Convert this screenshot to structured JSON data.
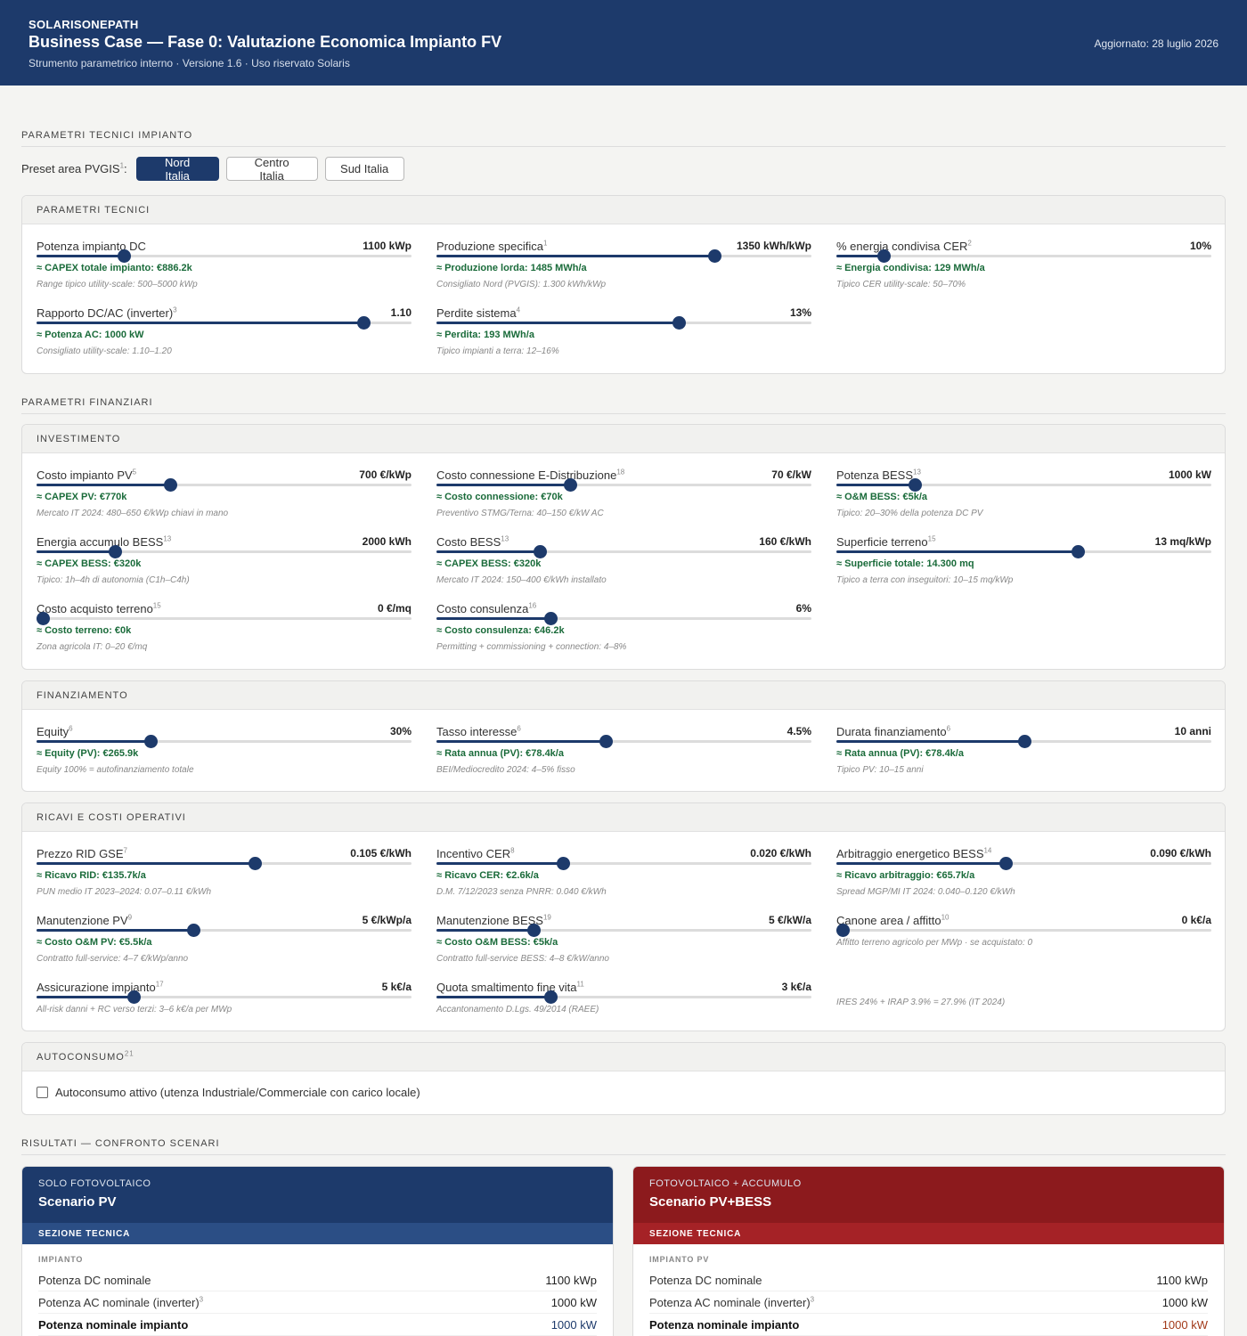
{
  "header": {
    "brand": "SOLARISONEPATH",
    "title": "Business Case — Fase 0: Valutazione Economica Impianto FV",
    "subtitle": "Strumento parametrico interno · Versione 1.6 · Uso riservato Solaris",
    "updated": "Aggiornato: 28 luglio 2026"
  },
  "sections": {
    "tech": "PARAMETRI TECNICI IMPIANTO",
    "fin": "PARAMETRI FINANZIARI",
    "results": "RISULTATI — CONFRONTO SCENARI"
  },
  "preset": {
    "label": "Preset area PVGIS",
    "sup": "1",
    "suffix": ":",
    "options": [
      "Nord Italia",
      "Centro Italia",
      "Sud Italia"
    ],
    "selected": "Nord Italia"
  },
  "cards": {
    "tecnici": {
      "title": "PARAMETRI TECNICI",
      "params": [
        {
          "label": "Potenza impianto DC",
          "sup": "",
          "value": "1100 kWp",
          "level": 0.233,
          "est": "≈ CAPEX totale impianto: €886.2k",
          "hint": "Range tipico utility-scale: 500–5000 kWp"
        },
        {
          "label": "Produzione specifica",
          "sup": "1",
          "value": "1350 kWh/kWp",
          "level": 0.74,
          "est": "≈ Produzione lorda: 1485 MWh/a",
          "hint": "Consigliato Nord (PVGIS): 1.300 kWh/kWp"
        },
        {
          "label": "% energia condivisa CER",
          "sup": "2",
          "value": "10%",
          "level": 0.125,
          "est": "≈ Energia condivisa: 129 MWh/a",
          "hint": "Tipico CER utility-scale: 50–70%"
        },
        {
          "label": "Rapporto DC/AC (inverter)",
          "sup": "3",
          "value": "1.10",
          "level": 0.872,
          "est": "≈ Potenza AC: 1000 kW",
          "hint": "Consigliato utility-scale: 1.10–1.20"
        },
        {
          "label": "Perdite sistema",
          "sup": "4",
          "value": "13%",
          "level": 0.645,
          "est": "≈ Perdita: 193 MWh/a",
          "hint": "Tipico impianti a terra: 12–16%"
        }
      ]
    },
    "investimento": {
      "title": "INVESTIMENTO",
      "params": [
        {
          "label": "Costo impianto PV",
          "sup": "5",
          "value": "700 €/kWp",
          "level": 0.357,
          "est": "≈ CAPEX PV: €770k",
          "hint": "Mercato IT 2024: 480–650 €/kWp chiavi in mano"
        },
        {
          "label": "Costo connessione E-Distribuzione",
          "sup": "18",
          "value": "70 €/kW",
          "level": 0.357,
          "est": "≈ Costo connessione: €70k",
          "hint": "Preventivo STMG/Terna: 40–150 €/kW AC"
        },
        {
          "label": "Potenza BESS",
          "sup": "13",
          "value": "1000 kW",
          "level": 0.21,
          "est": "≈ O&M BESS: €5k/a",
          "hint": "Tipico: 20–30% della potenza DC PV"
        },
        {
          "label": "Energia accumulo BESS",
          "sup": "13",
          "value": "2000 kWh",
          "level": 0.21,
          "est": "≈ CAPEX BESS: €320k",
          "hint": "Tipico: 1h–4h di autonomia (C1h–C4h)"
        },
        {
          "label": "Costo BESS",
          "sup": "13",
          "value": "160 €/kWh",
          "level": 0.276,
          "est": "≈ CAPEX BESS: €320k",
          "hint": "Mercato IT 2024: 150–400 €/kWh installato"
        },
        {
          "label": "Superficie terreno",
          "sup": "15",
          "value": "13 mq/kWp",
          "level": 0.643,
          "est": "≈ Superficie totale: 14.300 mq",
          "hint": "Tipico a terra con inseguitori: 10–15 mq/kWp"
        },
        {
          "label": "Costo acquisto terreno",
          "sup": "15",
          "value": "0 €/mq",
          "level": 0.017,
          "est": "≈ Costo terreno: €0k",
          "hint": "Zona agricola IT: 0–20 €/mq"
        },
        {
          "label": "Costo consulenza",
          "sup": "16",
          "value": "6%",
          "level": 0.305,
          "est": "≈ Costo consulenza: €46.2k",
          "hint": "Permitting + commissioning + connection: 4–8%"
        }
      ]
    },
    "finanziamento": {
      "title": "FINANZIAMENTO",
      "params": [
        {
          "label": "Equity",
          "sup": "6",
          "value": "30%",
          "level": 0.305,
          "est": "≈ Equity (PV): €265.9k",
          "hint": "Equity 100% = autofinanziamento totale"
        },
        {
          "label": "Tasso interesse",
          "sup": "6",
          "value": "4.5%",
          "level": 0.452,
          "est": "≈ Rata annua (PV): €78.4k/a",
          "hint": "BEI/Mediocredito 2024: 4–5% fisso"
        },
        {
          "label": "Durata finanziamento",
          "sup": "6",
          "value": "10 anni",
          "level": 0.5,
          "est": "≈ Rata annua (PV): €78.4k/a",
          "hint": "Tipico PV: 10–15 anni"
        }
      ]
    },
    "ricavi": {
      "title": "RICAVI E COSTI OPERATIVI",
      "params": [
        {
          "label": "Prezzo RID GSE",
          "sup": "7",
          "value": "0.105 €/kWh",
          "level": 0.581,
          "est": "≈ Ricavo RID: €135.7k/a",
          "hint": "PUN medio IT 2023–2024: 0.07–0.11 €/kWh"
        },
        {
          "label": "Incentivo CER",
          "sup": "8",
          "value": "0.020 €/kWh",
          "level": 0.338,
          "est": "≈ Ricavo CER: €2.6k/a",
          "hint": "D.M. 7/12/2023 senza PNRR: 0.040 €/kWh"
        },
        {
          "label": "Arbitraggio energetico BESS",
          "sup": "14",
          "value": "0.090 €/kWh",
          "level": 0.452,
          "est": "≈ Ricavo arbitraggio: €65.7k/a",
          "hint": "Spread MGP/MI IT 2024: 0.040–0.120 €/kWh"
        },
        {
          "label": "Manutenzione PV",
          "sup": "9",
          "value": "5 €/kWp/a",
          "level": 0.419,
          "est": "≈ Costo O&M PV: €5.5k/a",
          "hint": "Contratto full-service: 4–7 €/kWp/anno"
        },
        {
          "label": "Manutenzione BESS",
          "sup": "19",
          "value": "5 €/kW/a",
          "level": 0.26,
          "est": "≈ Costo O&M BESS: €5k/a",
          "hint": "Contratto full-service BESS: 4–8 €/kW/anno"
        },
        {
          "label": "Canone area / affitto",
          "sup": "10",
          "value": "0 k€/a",
          "level": 0.017,
          "est": "",
          "hint": "Affitto terreno agricolo per MWp · se acquistato: 0"
        },
        {
          "label": "Assicurazione impianto",
          "sup": "17",
          "value": "5 k€/a",
          "level": 0.26,
          "est": "",
          "hint": "All-risk danni + RC verso terzi: 3–6 k€/a per MWp"
        },
        {
          "label": "Quota smaltimento fine vita",
          "sup": "11",
          "value": "3 k€/a",
          "level": 0.305,
          "est": "",
          "hint": "Accantonamento D.Lgs. 49/2014 (RAEE)"
        }
      ],
      "tax_note": "IRES 24% + IRAP 3.9% = 27.9% (IT 2024)"
    },
    "autoconsumo": {
      "title": "AUTOCONSUMO",
      "sup": "21",
      "checkbox_label": "Autoconsumo attivo (utenza Industriale/Commerciale con carico locale)",
      "checked": false
    }
  },
  "scenarios": {
    "pv": {
      "kicker": "SOLO FOTOVOLTAICO",
      "name": "Scenario PV",
      "section": "SEZIONE TECNICA",
      "group": "IMPIANTO",
      "rows": [
        {
          "label": "Potenza DC nominale",
          "sup": "",
          "value": "1100 kWp"
        },
        {
          "label": "Potenza AC nominale (inverter)",
          "sup": "3",
          "value": "1000 kW"
        },
        {
          "label": "Potenza nominale impianto",
          "sup": "",
          "value": "1000 kW"
        }
      ]
    },
    "bess": {
      "kicker": "FOTOVOLTAICO + ACCUMULO",
      "name": "Scenario PV+BESS",
      "section": "SEZIONE TECNICA",
      "group": "IMPIANTO PV",
      "rows": [
        {
          "label": "Potenza DC nominale",
          "sup": "",
          "value": "1100 kWp"
        },
        {
          "label": "Potenza AC nominale (inverter)",
          "sup": "3",
          "value": "1000 kW"
        },
        {
          "label": "Potenza nominale impianto",
          "sup": "",
          "value": "1000 kW"
        }
      ]
    }
  },
  "colors": {
    "primary": "#1d3a6b",
    "bess": "#8c1a1d",
    "estimate": "#1a6b3a",
    "background": "#f4f4f2"
  }
}
